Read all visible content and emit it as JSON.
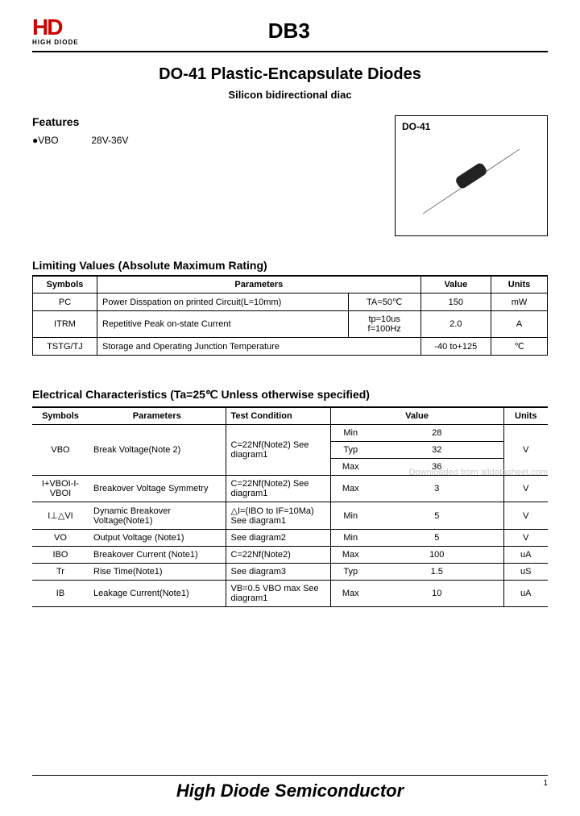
{
  "header": {
    "logo_brand": "HD",
    "logo_sub": "HIGH DIODE",
    "part_number": "DB3"
  },
  "titles": {
    "main": "DO-41 Plastic-Encapsulate Diodes",
    "sub": "Silicon bidirectional diac"
  },
  "features": {
    "heading": "Features",
    "vbo_label": "●VBO",
    "vbo_value": "28V-36V"
  },
  "package": {
    "label": "DO-41"
  },
  "limiting": {
    "heading": "Limiting Values (Absolute Maximum Rating)",
    "cols": {
      "symbols": "Symbols",
      "parameters": "Parameters",
      "value": "Value",
      "units": "Units"
    },
    "rows": [
      {
        "sym": "PC",
        "param": "Power Disspation on printed Circuit(L=10mm)",
        "cond": "TA=50℃",
        "val": "150",
        "unit": "mW"
      },
      {
        "sym": "ITRM",
        "param": "Repetitive Peak on-state Current",
        "cond": "tp=10us f=100Hz",
        "val": "2.0",
        "unit": "A"
      },
      {
        "sym": "TSTG/TJ",
        "param": "Storage and Operating Junction Temperature",
        "cond": "",
        "val": "-40 to+125",
        "unit": "℃"
      }
    ]
  },
  "electrical": {
    "heading": "Electrical Characteristics (Ta=25℃ Unless otherwise specified)",
    "cols": {
      "symbols": "Symbols",
      "parameters": "Parameters",
      "test": "Test Condition",
      "value": "Value",
      "units": "Units"
    },
    "rows": [
      {
        "sym": "VBO",
        "param": "Break Voltage(Note 2)",
        "cond": "C=22Nf(Note2) See diagram1",
        "sub": "Min",
        "val": "28",
        "unit": "V"
      },
      {
        "sym": "",
        "param": "",
        "cond": "",
        "sub": "Typ",
        "val": "32",
        "unit": ""
      },
      {
        "sym": "",
        "param": "",
        "cond": "",
        "sub": "Max",
        "val": "36",
        "unit": ""
      },
      {
        "sym": "I+VBOI-I-VBOI",
        "param": "Breakover Voltage Symmetry",
        "cond": "C=22Nf(Note2) See diagram1",
        "sub": "Max",
        "val": "3",
        "unit": "V"
      },
      {
        "sym": "I⊥△VI",
        "param": "Dynamic Breakover Voltage(Note1)",
        "cond": "△I=(IBO to IF=10Ma) See diagram1",
        "sub": "Min",
        "val": "5",
        "unit": "V"
      },
      {
        "sym": "VO",
        "param": "Output Voltage (Note1)",
        "cond": "See diagram2",
        "sub": "Min",
        "val": "5",
        "unit": "V"
      },
      {
        "sym": "IBO",
        "param": "Breakover Current (Note1)",
        "cond": "C=22Nf(Note2)",
        "sub": "Max",
        "val": "100",
        "unit": "uA"
      },
      {
        "sym": "Tr",
        "param": "Rise Time(Note1)",
        "cond": "See diagram3",
        "sub": "Typ",
        "val": "1.5",
        "unit": "uS"
      },
      {
        "sym": "IB",
        "param": "Leakage Current(Note1)",
        "cond": "VB=0.5 VBO max See diagram1",
        "sub": "Max",
        "val": "10",
        "unit": "uA"
      }
    ]
  },
  "watermark": "Downloaded from alldatasheet.com",
  "footer": {
    "company": "High Diode Semiconductor",
    "page": "1"
  }
}
